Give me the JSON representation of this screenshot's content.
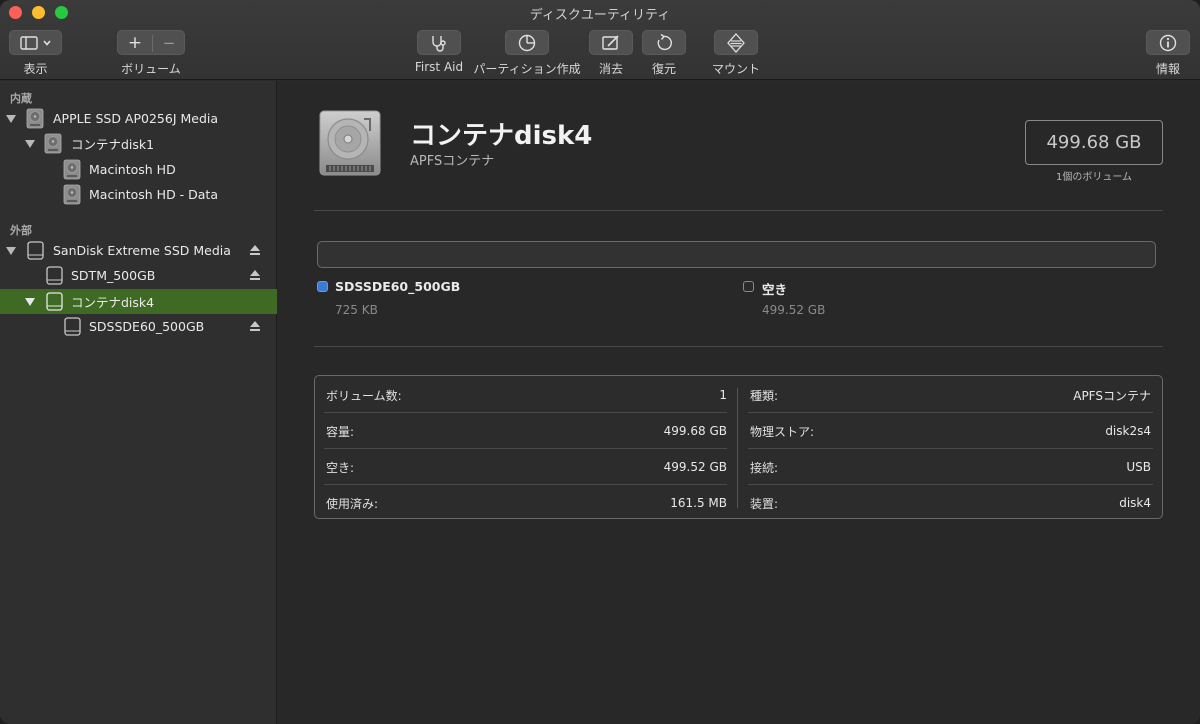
{
  "window": {
    "title": "ディスクユーティリティ"
  },
  "toolbar": {
    "view_label": "表示",
    "volume_label": "ボリューム",
    "first_aid_label": "First Aid",
    "partition_label": "パーティション作成",
    "erase_label": "消去",
    "restore_label": "復元",
    "mount_label": "マウント",
    "info_label": "情報",
    "add_glyph": "+",
    "remove_glyph": "−"
  },
  "sidebar": {
    "internal_heading": "内蔵",
    "external_heading": "外部",
    "items": [
      {
        "label": "APPLE SSD AP0256J Media",
        "icon": "internal-disk-icon"
      },
      {
        "label": "コンテナdisk1",
        "icon": "internal-disk-icon"
      },
      {
        "label": "Macintosh HD",
        "icon": "internal-disk-icon"
      },
      {
        "label": "Macintosh HD - Data",
        "icon": "internal-disk-icon"
      },
      {
        "label": "SanDisk Extreme SSD Media",
        "icon": "external-disk-icon"
      },
      {
        "label": "SDTM_500GB",
        "icon": "external-disk-icon"
      },
      {
        "label": "コンテナdisk4",
        "icon": "external-disk-icon"
      },
      {
        "label": "SDSSDE60_500GB",
        "icon": "external-disk-icon"
      }
    ],
    "selected_color": "#3e6a24"
  },
  "header": {
    "title": "コンテナdisk4",
    "subtitle": "APFSコンテナ",
    "capacity": "499.68 GB",
    "capacity_sub": "1個のボリューム"
  },
  "usage": {
    "items": [
      {
        "name": "SDSSDE60_500GB",
        "size": "725 KB",
        "color": "#3a7bd5"
      },
      {
        "name": "空き",
        "size": "499.52 GB",
        "color": "#2a2a2a"
      }
    ]
  },
  "info": {
    "left": [
      {
        "key": "ボリューム数:",
        "value": "1"
      },
      {
        "key": "容量:",
        "value": "499.68 GB"
      },
      {
        "key": "空き:",
        "value": "499.52 GB"
      },
      {
        "key": "使用済み:",
        "value": "161.5 MB"
      }
    ],
    "right": [
      {
        "key": "種類:",
        "value": "APFSコンテナ"
      },
      {
        "key": "物理ストア:",
        "value": "disk2s4"
      },
      {
        "key": "接続:",
        "value": "USB"
      },
      {
        "key": "装置:",
        "value": "disk4"
      }
    ]
  }
}
